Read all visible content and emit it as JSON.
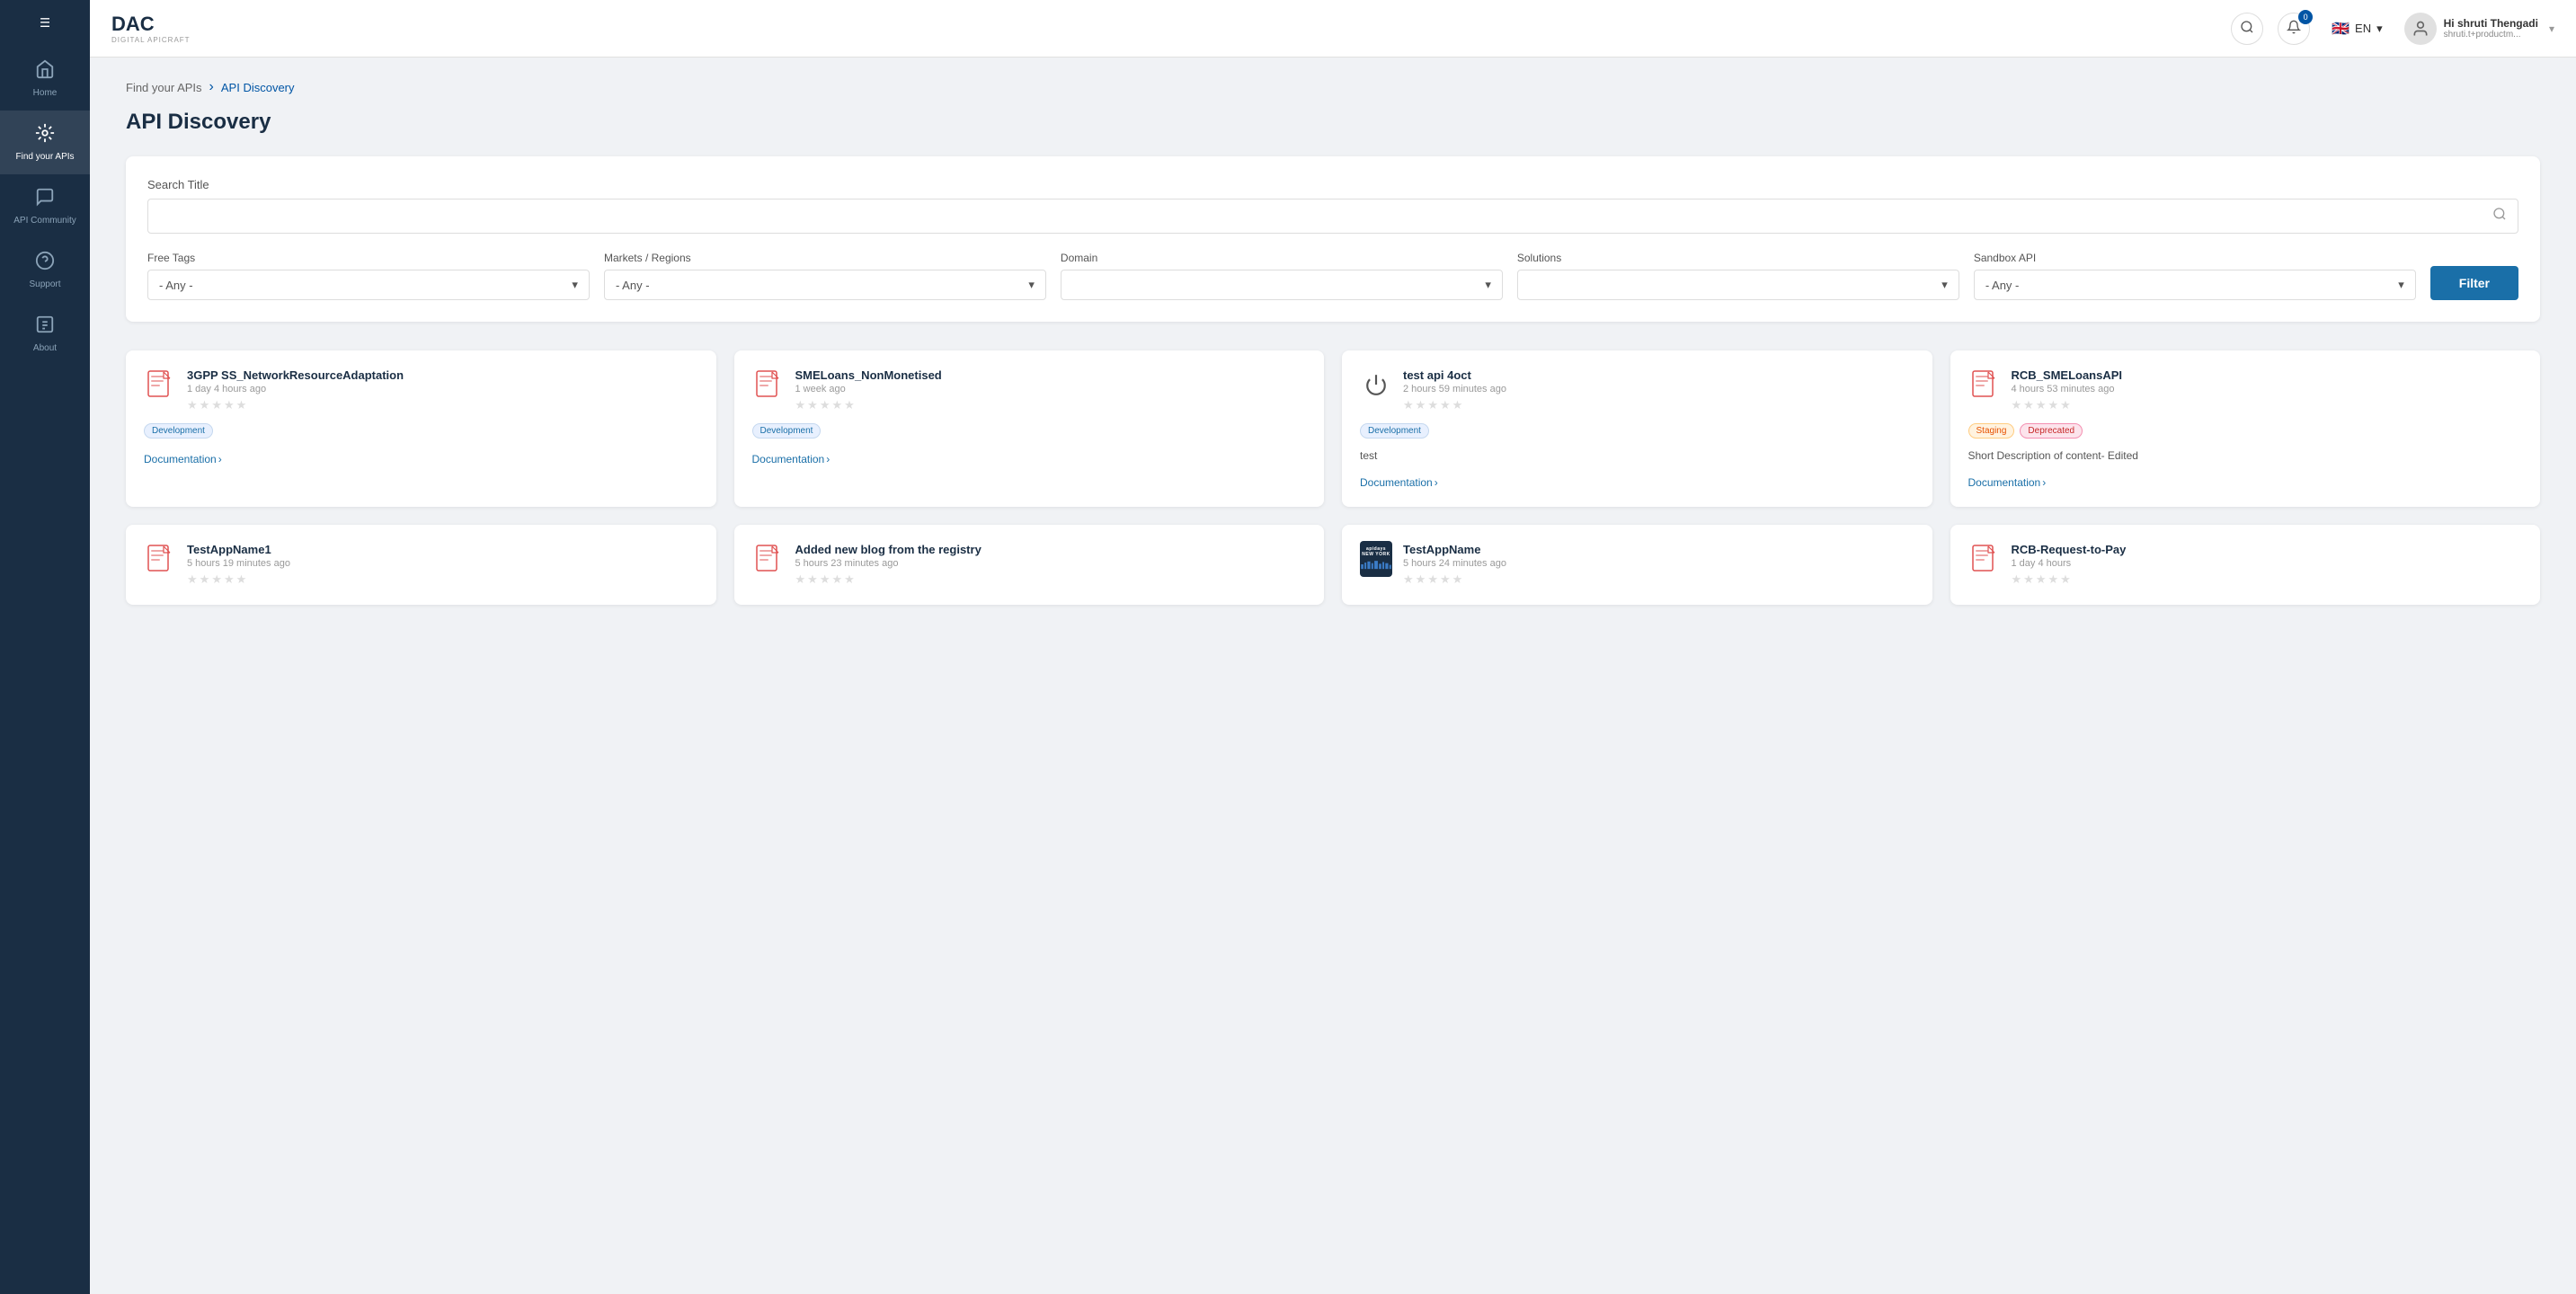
{
  "sidebar": {
    "menu_icon": "☰",
    "items": [
      {
        "id": "home",
        "label": "Home",
        "icon": "⌂",
        "active": false
      },
      {
        "id": "find-apis",
        "label": "Find your APIs",
        "icon": "⚙",
        "active": true
      },
      {
        "id": "api-community",
        "label": "API Community",
        "icon": "💬",
        "active": false
      },
      {
        "id": "support",
        "label": "Support",
        "icon": "⊙",
        "active": false
      },
      {
        "id": "about",
        "label": "About",
        "icon": "📄",
        "active": false
      }
    ]
  },
  "header": {
    "logo_main": "DAC",
    "logo_sub": "DIGITAL APICRAFT",
    "search_tooltip": "Search",
    "notification_count": "0",
    "lang": "EN",
    "user_greeting": "Hi shruti Thengadi",
    "user_email": "shruti.t+productm..."
  },
  "breadcrumb": {
    "parent": "Find your APIs",
    "current": "API Discovery"
  },
  "page_title": "API Discovery",
  "search": {
    "label": "Search Title",
    "placeholder": ""
  },
  "filters": {
    "free_tags": {
      "label": "Free Tags",
      "value": "- Any -"
    },
    "markets_regions": {
      "label": "Markets / Regions",
      "value": "- Any -"
    },
    "domain": {
      "label": "Domain",
      "value": ""
    },
    "solutions": {
      "label": "Solutions",
      "value": ""
    },
    "sandbox_api": {
      "label": "Sandbox API",
      "value": "- Any -"
    },
    "filter_btn": "Filter"
  },
  "api_cards": [
    {
      "id": "card1",
      "icon_type": "svg",
      "name": "3GPP SS_NetworkResourceAdaptation",
      "time": "1 day 4 hours ago",
      "stars": [
        false,
        false,
        false,
        false,
        false
      ],
      "badges": [
        "Development"
      ],
      "description": "",
      "doc_link": "Documentation"
    },
    {
      "id": "card2",
      "icon_type": "svg",
      "name": "SMELoans_NonMonetised",
      "time": "1 week ago",
      "stars": [
        false,
        false,
        false,
        false,
        false
      ],
      "badges": [
        "Development"
      ],
      "description": "",
      "doc_link": "Documentation"
    },
    {
      "id": "card3",
      "icon_type": "power",
      "name": "test api 4oct",
      "time": "2 hours 59 minutes ago",
      "stars": [
        false,
        false,
        false,
        false,
        false
      ],
      "badges": [
        "Development"
      ],
      "description": "test",
      "doc_link": "Documentation"
    },
    {
      "id": "card4",
      "icon_type": "svg",
      "name": "RCB_SMELoansAPI",
      "time": "4 hours 53 minutes ago",
      "stars": [
        false,
        false,
        false,
        false,
        false
      ],
      "badges": [
        "Staging",
        "Deprecated"
      ],
      "description": "Short Description of content- Edited",
      "doc_link": "Documentation"
    },
    {
      "id": "card5",
      "icon_type": "svg",
      "name": "TestAppName1",
      "time": "5 hours 19 minutes ago",
      "stars": [
        false,
        false,
        false,
        false,
        false
      ],
      "badges": [],
      "description": "",
      "doc_link": ""
    },
    {
      "id": "card6",
      "icon_type": "svg",
      "name": "Added new blog from the registry",
      "time": "5 hours 23 minutes ago",
      "stars": [
        false,
        false,
        false,
        false,
        false
      ],
      "badges": [],
      "description": "",
      "doc_link": ""
    },
    {
      "id": "card7",
      "icon_type": "apidays",
      "name": "TestAppName",
      "time": "5 hours 24 minutes ago",
      "stars": [
        false,
        false,
        false,
        false,
        false
      ],
      "badges": [],
      "description": "",
      "doc_link": ""
    },
    {
      "id": "card8",
      "icon_type": "svg",
      "name": "RCB-Request-to-Pay",
      "time": "1 day 4 hours",
      "stars": [
        false,
        false,
        false,
        false,
        false
      ],
      "badges": [],
      "description": "",
      "doc_link": ""
    }
  ]
}
